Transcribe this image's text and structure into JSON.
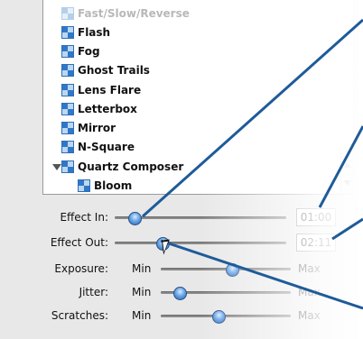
{
  "list": {
    "items": [
      {
        "label": "Fast/Slow/Reverse",
        "faded": true
      },
      {
        "label": "Flash"
      },
      {
        "label": "Fog"
      },
      {
        "label": "Ghost Trails"
      },
      {
        "label": "Lens Flare"
      },
      {
        "label": "Letterbox"
      },
      {
        "label": "Mirror"
      },
      {
        "label": "N-Square"
      },
      {
        "label": "Quartz Composer",
        "expanded": true
      },
      {
        "label": "Bloom",
        "child": true
      }
    ]
  },
  "controls": {
    "effect_in": {
      "label": "Effect In:",
      "time": "01:00",
      "level": 0.12
    },
    "effect_out": {
      "label": "Effect Out:",
      "time": "02:11",
      "level": 0.28
    },
    "exposure": {
      "label": "Exposure:",
      "min": "Min",
      "max": "Max",
      "level": 0.55
    },
    "jitter": {
      "label": "Jitter:",
      "min": "Min",
      "max": "Max",
      "level": 0.15
    },
    "scratches": {
      "label": "Scratches:",
      "min": "Min",
      "max": "Max",
      "level": 0.45
    }
  },
  "colors": {
    "accent": "#1f5f9f",
    "callout": "#1e5b99"
  }
}
